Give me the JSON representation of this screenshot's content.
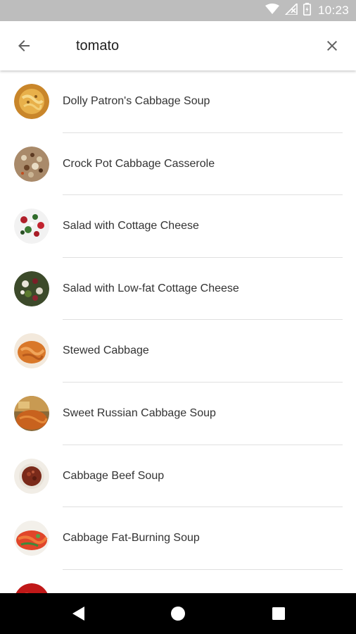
{
  "status_bar": {
    "time": "10:23",
    "icons": [
      "wifi-icon",
      "no-signal-icon",
      "battery-icon"
    ]
  },
  "search": {
    "value": "tomato",
    "back_icon": "arrow-left-icon",
    "clear_icon": "close-icon"
  },
  "results": [
    {
      "label": "Dolly Patron's Cabbage Soup",
      "thumb": "soup-thumbnail"
    },
    {
      "label": "Crock Pot Cabbage Casserole",
      "thumb": "casserole-thumbnail"
    },
    {
      "label": "Salad with Cottage Cheese",
      "thumb": "salad-thumbnail"
    },
    {
      "label": "Salad with Low-fat Cottage Cheese",
      "thumb": "salad-thumbnail"
    },
    {
      "label": "Stewed Cabbage",
      "thumb": "stew-thumbnail"
    },
    {
      "label": "Sweet Russian Cabbage Soup",
      "thumb": "soup-thumbnail"
    },
    {
      "label": "Cabbage Beef Soup",
      "thumb": "soup-thumbnail"
    },
    {
      "label": "Cabbage Fat-Burning Soup",
      "thumb": "soup-thumbnail"
    },
    {
      "label": "",
      "thumb": "partial-thumbnail"
    }
  ],
  "nav_bar": {
    "icons": [
      "back-triangle-icon",
      "home-circle-icon",
      "recents-square-icon"
    ]
  },
  "colors": {
    "status_bar_bg": "#bdbdbd",
    "nav_bar_bg": "#000000",
    "text_primary": "#212121",
    "icon_gray": "#616161",
    "divider": "#e0e0e0"
  }
}
